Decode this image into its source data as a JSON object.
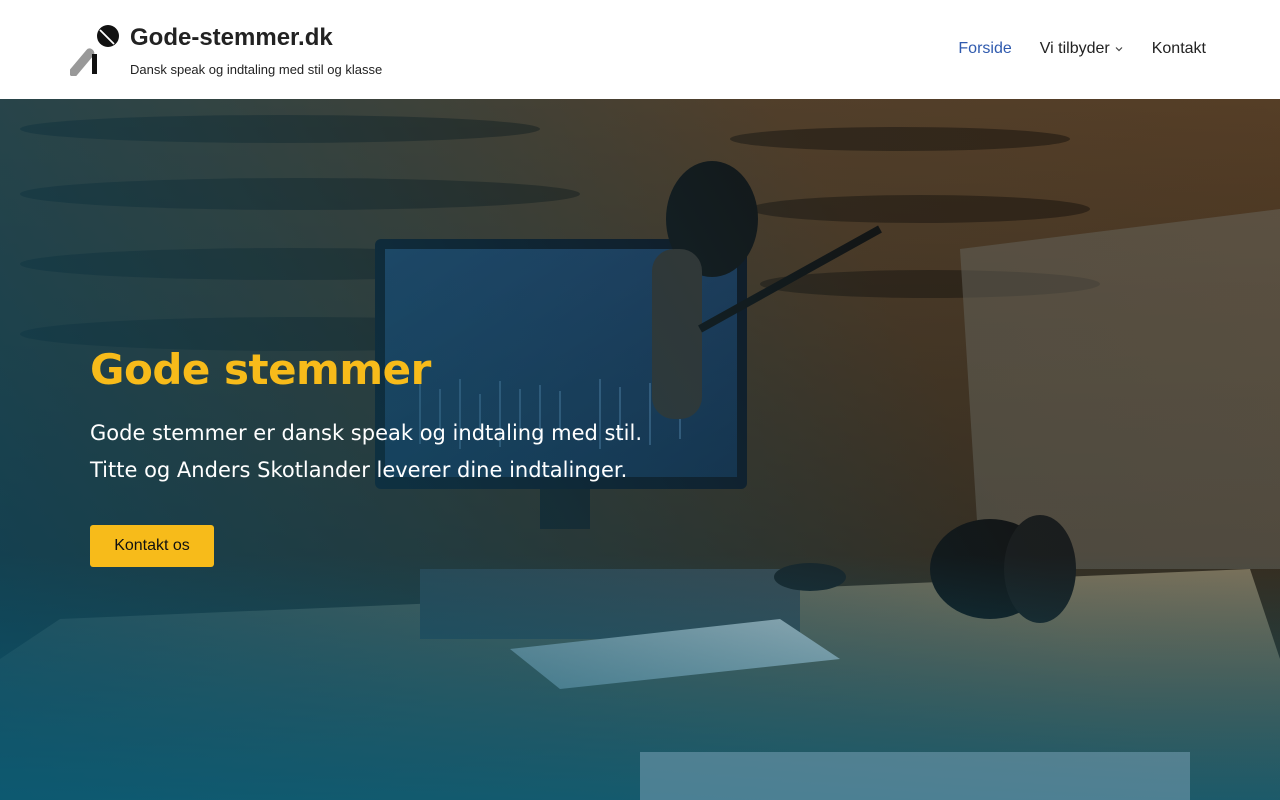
{
  "brand": {
    "title": "Gode-stemmer.dk",
    "tagline": "Dansk speak og indtaling med stil og klasse",
    "logo_icon": "microphone-icon"
  },
  "nav": {
    "items": [
      {
        "label": "Forside",
        "active": true
      },
      {
        "label": "Vi tilbyder",
        "has_dropdown": true
      },
      {
        "label": "Kontakt"
      }
    ]
  },
  "hero": {
    "title": "Gode stemmer",
    "line1": "Gode stemmer er dansk speak og indtaling med stil.",
    "line2": "Titte og Anders Skotlander leverer dine indtalinger.",
    "cta_label": "Kontakt os"
  },
  "colors": {
    "accent": "#f7bb1a",
    "nav_active": "#2f5aae",
    "overlay": "#0a5f78"
  }
}
